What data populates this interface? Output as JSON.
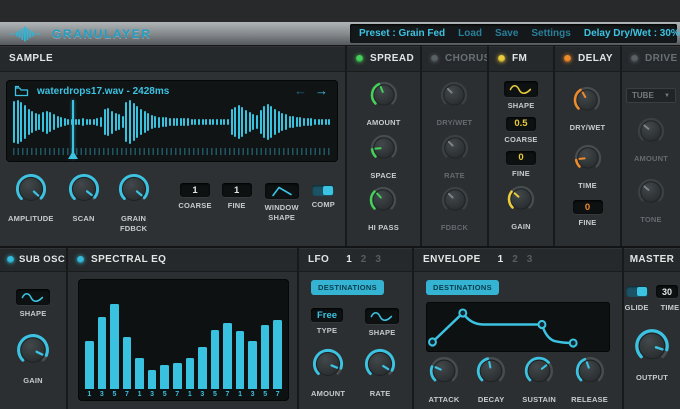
{
  "header": {
    "app_title": "GRANULAYER",
    "preset": "Preset : Grain Fed",
    "load": "Load",
    "save": "Save",
    "settings": "Settings",
    "param_readout": "Delay Dry/Wet : 30%"
  },
  "colors": {
    "cyan": "#3cc3e2",
    "green": "#45d05a",
    "yellow": "#e9cb3d",
    "orange": "#ef8b2b",
    "disabled": "#5a6164"
  },
  "sample": {
    "title": "SAMPLE",
    "file_label": "waterdrops17.wav -  2428ms",
    "prev": "←",
    "next": "→",
    "playhead_fraction": 0.196,
    "waveform_bars": [
      0.92,
      0.96,
      0.85,
      0.72,
      0.58,
      0.48,
      0.4,
      0.36,
      0.44,
      0.5,
      0.42,
      0.35,
      0.28,
      0.22,
      0.18,
      0.15,
      0.14,
      0.13,
      0.14,
      0.16,
      0.15,
      0.13,
      0.14,
      0.16,
      0.22,
      0.55,
      0.62,
      0.5,
      0.38,
      0.33,
      0.28,
      0.88,
      0.95,
      0.82,
      0.68,
      0.56,
      0.46,
      0.38,
      0.32,
      0.27,
      0.24,
      0.22,
      0.2,
      0.19,
      0.18,
      0.17,
      0.17,
      0.16,
      0.16,
      0.15,
      0.15,
      0.14,
      0.14,
      0.13,
      0.13,
      0.13,
      0.12,
      0.12,
      0.12,
      0.11,
      0.58,
      0.66,
      0.72,
      0.64,
      0.52,
      0.42,
      0.35,
      0.3,
      0.52,
      0.7,
      0.78,
      0.7,
      0.58,
      0.48,
      0.4,
      0.34,
      0.28,
      0.25,
      0.22,
      0.2,
      0.18,
      0.17,
      0.16,
      0.15,
      0.14,
      0.13,
      0.12,
      0.11
    ],
    "knobs": {
      "amplitude": {
        "label": "AMPLITUDE",
        "color": "#3cc3e2",
        "end": 132,
        "ind": 132,
        "size": 34
      },
      "scan": {
        "label": "SCAN",
        "color": "#3cc3e2",
        "end": 128,
        "ind": 128,
        "size": 34
      },
      "grain": {
        "label": "GRAIN FDBCK",
        "color": "#3cc3e2",
        "end": 130,
        "ind": 130,
        "size": 34
      }
    },
    "coarse": {
      "label": "COARSE",
      "value": "1"
    },
    "fine": {
      "label": "FINE",
      "value": "1"
    },
    "window": {
      "label": "WINDOW SHAPE"
    },
    "comp": {
      "label": "COMP",
      "on": true
    }
  },
  "spread": {
    "title": "SPREAD",
    "led": "#45d05a",
    "knobs": {
      "amount": {
        "label": "AMOUNT",
        "color": "#45d05a",
        "end": -25,
        "ind": -22,
        "size": 30
      },
      "space": {
        "label": "SPACE",
        "color": "#45d05a",
        "end": -97,
        "ind": -94,
        "size": 30
      },
      "hipass": {
        "label": "HI PASS",
        "color": "#45d05a",
        "end": -45,
        "ind": -42,
        "size": 30
      }
    }
  },
  "chorus": {
    "title": "CHORUS",
    "led": "#5a6164",
    "knobs": {
      "drywet": {
        "label": "DRY/WET",
        "disabled": true,
        "ind": -45,
        "size": 30
      },
      "rate": {
        "label": "RATE",
        "disabled": true,
        "ind": -45,
        "size": 30
      },
      "fdbck": {
        "label": "FDBCK",
        "disabled": true,
        "ind": -45,
        "size": 30
      }
    }
  },
  "fm": {
    "title": "FM",
    "led": "#e9cb3d",
    "shape_label": "SHAPE",
    "coarse": {
      "label": "COARSE",
      "value": "0.5"
    },
    "fine": {
      "label": "FINE",
      "value": "0"
    },
    "knobs": {
      "gain": {
        "label": "GAIN",
        "color": "#e9cb3d",
        "end": -52,
        "ind": -48,
        "size": 30
      }
    }
  },
  "delay": {
    "title": "DELAY",
    "led": "#ef8b2b",
    "knobs": {
      "drywet": {
        "label": "DRY/WET",
        "color": "#ef8b2b",
        "end": -33,
        "ind": -30,
        "size": 30
      },
      "time": {
        "label": "TIME",
        "color": "#ef8b2b",
        "end": -100,
        "ind": -96,
        "size": 30
      }
    },
    "fine": {
      "label": "FINE",
      "value": "0"
    }
  },
  "drive": {
    "title": "DRIVE",
    "led": "#5a6164",
    "type_value": "TUBE",
    "dropdown_arrow": "▼",
    "knobs": {
      "amount": {
        "label": "AMOUNT",
        "disabled": true,
        "ind": -50,
        "size": 30
      },
      "tone": {
        "label": "TONE",
        "disabled": true,
        "ind": -50,
        "size": 30
      }
    }
  },
  "sub_osc": {
    "title": "SUB OSC",
    "led": "#35bcdb",
    "shape_label": "SHAPE",
    "knobs": {
      "gain": {
        "label": "GAIN",
        "color": "#3cc3e2",
        "end": 112,
        "ind": 116,
        "size": 36
      }
    }
  },
  "spectral_eq": {
    "title": "SPECTRAL EQ",
    "led": "#35bcdb",
    "bars": [
      0.51,
      0.77,
      0.9,
      0.55,
      0.33,
      0.2,
      0.26,
      0.28,
      0.33,
      0.45,
      0.63,
      0.7,
      0.62,
      0.51,
      0.68,
      0.73
    ],
    "labels": [
      "1",
      "3",
      "5",
      "7",
      "1",
      "3",
      "5",
      "7",
      "1",
      "3",
      "5",
      "7",
      "1",
      "3",
      "5",
      "7"
    ]
  },
  "lfo": {
    "title": "LFO",
    "tabs": [
      "1",
      "2",
      "3"
    ],
    "active_tab": "1",
    "destinations": "DESTINATIONS",
    "type": {
      "label": "TYPE",
      "value": "Free"
    },
    "shape_label": "SHAPE",
    "knobs": {
      "amount": {
        "label": "AMOUNT",
        "color": "#3cc3e2",
        "end": 108,
        "ind": 112,
        "size": 34
      },
      "rate": {
        "label": "RATE",
        "color": "#3cc3e2",
        "end": 118,
        "ind": 122,
        "size": 34
      }
    }
  },
  "envelope": {
    "title": "ENVELOPE",
    "tabs": [
      "1",
      "2",
      "3"
    ],
    "destinations": "DESTINATIONS",
    "points": [
      [
        0.035,
        0.8
      ],
      [
        0.2,
        0.22
      ],
      [
        0.63,
        0.45
      ],
      [
        0.8,
        0.82
      ]
    ],
    "knobs": {
      "attack": {
        "label": "ATTACK",
        "color": "#3cc3e2",
        "end": -70,
        "ind": -66,
        "size": 32
      },
      "decay": {
        "label": "DECAY",
        "color": "#3cc3e2",
        "end": -15,
        "ind": -11,
        "size": 32
      },
      "sustain": {
        "label": "SUSTAIN",
        "color": "#3cc3e2",
        "end": 48,
        "ind": 52,
        "size": 32
      },
      "release": {
        "label": "RELEASE",
        "color": "#3cc3e2",
        "end": -24,
        "ind": -20,
        "size": 32
      }
    }
  },
  "master": {
    "title": "MASTER",
    "glide_label": "GLIDE",
    "time": {
      "label": "TIME",
      "value": "30"
    },
    "knobs": {
      "output": {
        "label": "OUTPUT",
        "color": "#3cc3e2",
        "end": 104,
        "ind": 108,
        "size": 38
      }
    }
  }
}
